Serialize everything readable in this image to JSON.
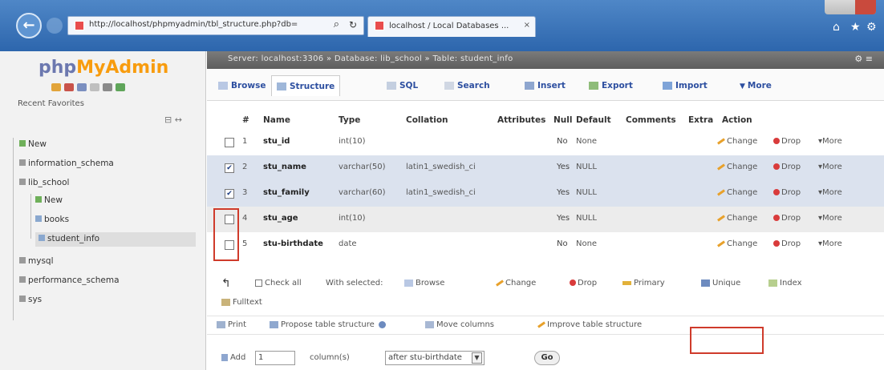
{
  "browser": {
    "address_url": "http://localhost/phpmyadmin/tbl_structure.php?db=",
    "tab_title": "localhost / Local Databases ...",
    "tab_close": "×",
    "search_glyph": "⌕",
    "refresh_glyph": "↻",
    "home_glyph": "⌂",
    "star_glyph": "★",
    "gear_glyph": "⚙"
  },
  "nav": {
    "logo_part1": "php",
    "logo_part2": "MyAdmin",
    "tabs_label": "Recent  Favorites",
    "collapse_glyph": "⊟ ↔",
    "tree": [
      {
        "label": "New",
        "icon": "new-icon"
      },
      {
        "label": "information_schema",
        "icon": "database-icon"
      },
      {
        "label": "lib_school",
        "icon": "database-icon"
      },
      {
        "label": "New",
        "icon": "new-icon"
      },
      {
        "label": "books",
        "icon": "table-icon"
      },
      {
        "label": "student_info",
        "icon": "table-icon"
      },
      {
        "label": "mysql",
        "icon": "database-icon"
      },
      {
        "label": "performance_schema",
        "icon": "database-icon"
      },
      {
        "label": "sys",
        "icon": "database-icon"
      }
    ]
  },
  "main": {
    "breadcrumb": "Server: localhost:3306 » Database: lib_school » Table: student_info",
    "breadcrumb_ctrl": "⚙  ≡",
    "tabs": [
      {
        "label": "Browse",
        "icon": "browse-icon"
      },
      {
        "label": "Structure",
        "icon": "structure-icon"
      },
      {
        "label": "SQL",
        "icon": "sql-icon"
      },
      {
        "label": "Search",
        "icon": "search-icon"
      },
      {
        "label": "Insert",
        "icon": "insert-icon"
      },
      {
        "label": "Export",
        "icon": "export-icon"
      },
      {
        "label": "Import",
        "icon": "import-icon"
      },
      {
        "label": "More",
        "icon": "more-icon"
      }
    ],
    "columns": [
      "#",
      "Name",
      "Type",
      "Collation",
      "Attributes",
      "Null",
      "Default",
      "Comments",
      "Extra",
      "Action"
    ],
    "rows": [
      {
        "num": "1",
        "name": "stu_id",
        "type": "int(10)",
        "collation": "",
        "null": "No",
        "default": "None",
        "checked": false
      },
      {
        "num": "2",
        "name": "stu_name",
        "type": "varchar(50)",
        "collation": "latin1_swedish_ci",
        "null": "Yes",
        "default": "NULL",
        "checked": true
      },
      {
        "num": "3",
        "name": "stu_family",
        "type": "varchar(60)",
        "collation": "latin1_swedish_ci",
        "null": "Yes",
        "default": "NULL",
        "checked": true
      },
      {
        "num": "4",
        "name": "stu_age",
        "type": "int(10)",
        "collation": "",
        "null": "Yes",
        "default": "NULL",
        "checked": false
      },
      {
        "num": "5",
        "name": "stu-birthdate",
        "type": "date",
        "collation": "",
        "null": "No",
        "default": "None",
        "checked": false
      }
    ],
    "row_actions": {
      "change": "Change",
      "drop": "Drop",
      "more": "▾More"
    },
    "bulk": {
      "check_all": "Check all",
      "with_selected": "With selected:",
      "browse": "Browse",
      "change": "Change",
      "drop": "Drop",
      "primary": "Primary",
      "unique": "Unique",
      "index": "Index",
      "fulltext": "Fulltext"
    },
    "tools": {
      "print": "Print",
      "propose": "Propose table structure",
      "move": "Move columns",
      "improve": "Improve table structure"
    },
    "add": {
      "add_label": "Add",
      "count": "1",
      "columns_label": "column(s)",
      "position": "after stu-birthdate",
      "go": "Go"
    }
  }
}
